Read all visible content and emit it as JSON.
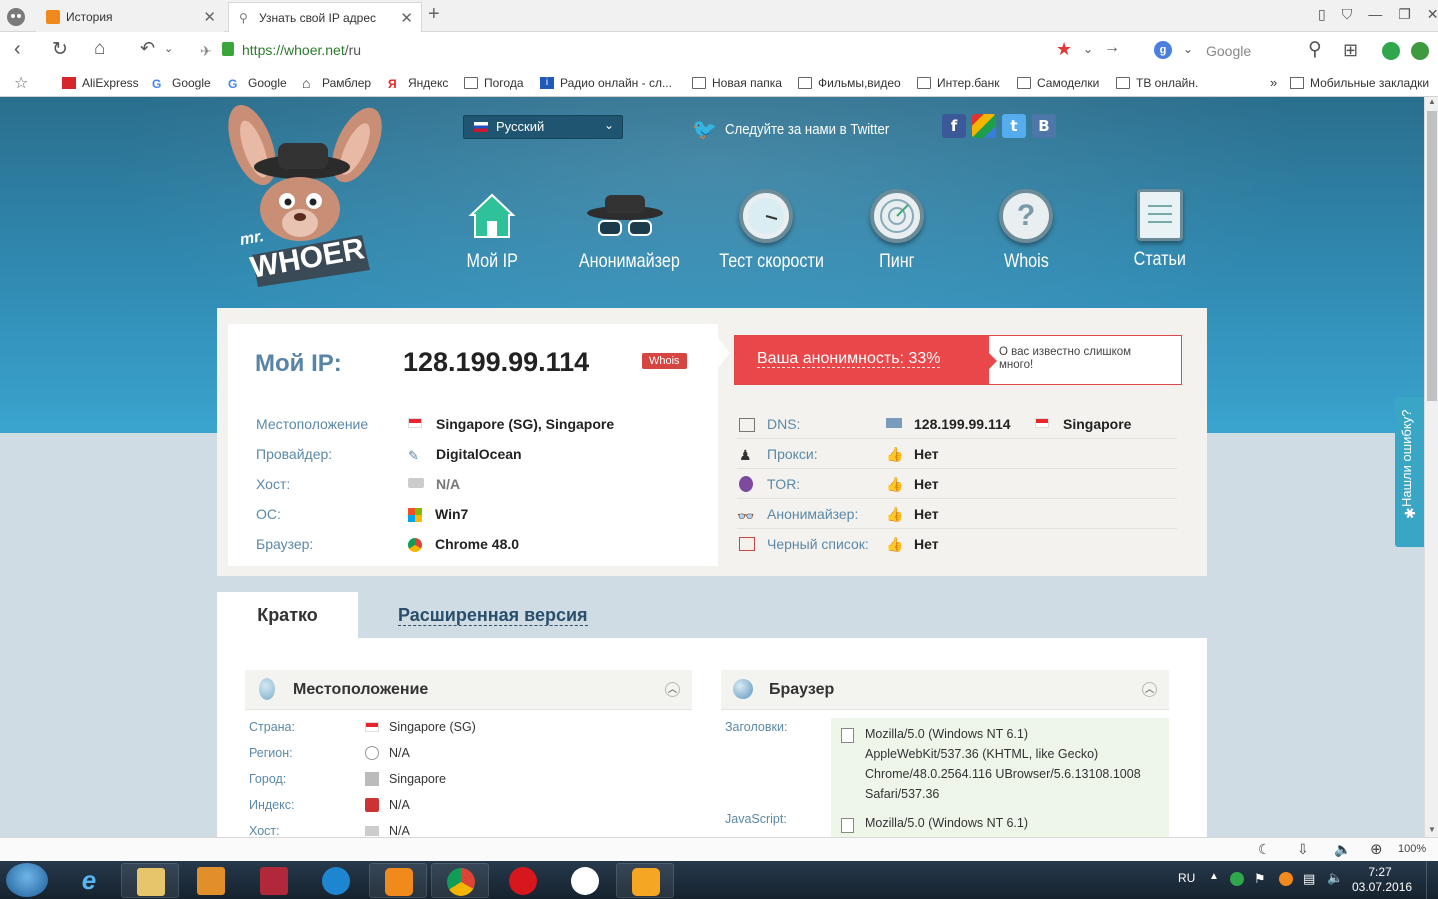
{
  "browser": {
    "tabs": [
      {
        "label": "История",
        "active": false
      },
      {
        "label": "Узнать свой IP адрес",
        "active": true
      }
    ],
    "url_host": "https://whoer.net",
    "url_path": "/ru",
    "search_engine": "Google",
    "zoom": "100%"
  },
  "bookmarks": [
    "AliExpress",
    "Google",
    "Google",
    "Рамблер",
    "Яндекс",
    "Погода",
    "Радио онлайн - сл...",
    "Новая папка",
    "Фильмы,видео",
    "Интер.банк",
    "Самоделки",
    "ТВ онлайн."
  ],
  "mobile_bookmarks": "Мобильные закладки",
  "overflow_chevron": "»",
  "site": {
    "logo_mr": "mr.",
    "logo_name": "WHOER",
    "language": "Русский",
    "twitter_text": "Следуйте за нами в Twitter",
    "social": [
      "f",
      "g+",
      "t",
      "B"
    ],
    "nav": [
      "Мой IP",
      "Анонимайзер",
      "Тест скорости",
      "Пинг",
      "Whois",
      "Статьи"
    ]
  },
  "ipinfo": {
    "my_ip_label": "Мой IP:",
    "my_ip": "128.199.99.114",
    "whois_badge": "Whois",
    "anonymity": "Ваша анонимность: 33%",
    "anonymity_note": "О вас известно слишком много!",
    "left_rows": [
      {
        "label": "Местоположение",
        "value": "Singapore (SG), Singapore"
      },
      {
        "label": "Провайдер:",
        "value": "DigitalOcean"
      },
      {
        "label": "Хост:",
        "value": "N/A"
      },
      {
        "label": "ОС:",
        "value": "Win7"
      },
      {
        "label": "Браузер:",
        "value": "Chrome 48.0"
      }
    ],
    "right_rows": [
      {
        "label": "DNS:",
        "value": "128.199.99.114",
        "extra": "Singapore"
      },
      {
        "label": "Прокси:",
        "value": "Нет"
      },
      {
        "label": "TOR:",
        "value": "Нет"
      },
      {
        "label": "Анонимайзер:",
        "value": "Нет"
      },
      {
        "label": "Черный список:",
        "value": "Нет"
      }
    ]
  },
  "tabs": {
    "brief": "Кратко",
    "extended": "Расширенная версия"
  },
  "location_section": {
    "title": "Местоположение",
    "rows": [
      {
        "label": "Страна:",
        "value": "Singapore (SG)"
      },
      {
        "label": "Регион:",
        "value": "N/A"
      },
      {
        "label": "Город:",
        "value": "Singapore"
      },
      {
        "label": "Индекс:",
        "value": "N/A"
      },
      {
        "label": "Хост:",
        "value": "N/A"
      }
    ]
  },
  "browser_section": {
    "title": "Браузер",
    "headers_label": "Заголовки:",
    "headers_value": [
      "Mozilla/5.0 (Windows NT 6.1)",
      "AppleWebKit/537.36 (KHTML, like Gecko)",
      "Chrome/48.0.2564.116 UBrowser/5.6.13108.1008",
      "Safari/537.36"
    ],
    "js_label": "JavaScript:",
    "js_value": "Mozilla/5.0 (Windows NT 6.1)"
  },
  "feedback": "Нашли ошибку?",
  "taskbar": {
    "lang": "RU",
    "time": "7:27",
    "date": "03.07.2016"
  },
  "colors": {
    "accent_blue": "#2f86ad",
    "danger_red": "#e9474a",
    "label_blue": "#5b88a8"
  }
}
